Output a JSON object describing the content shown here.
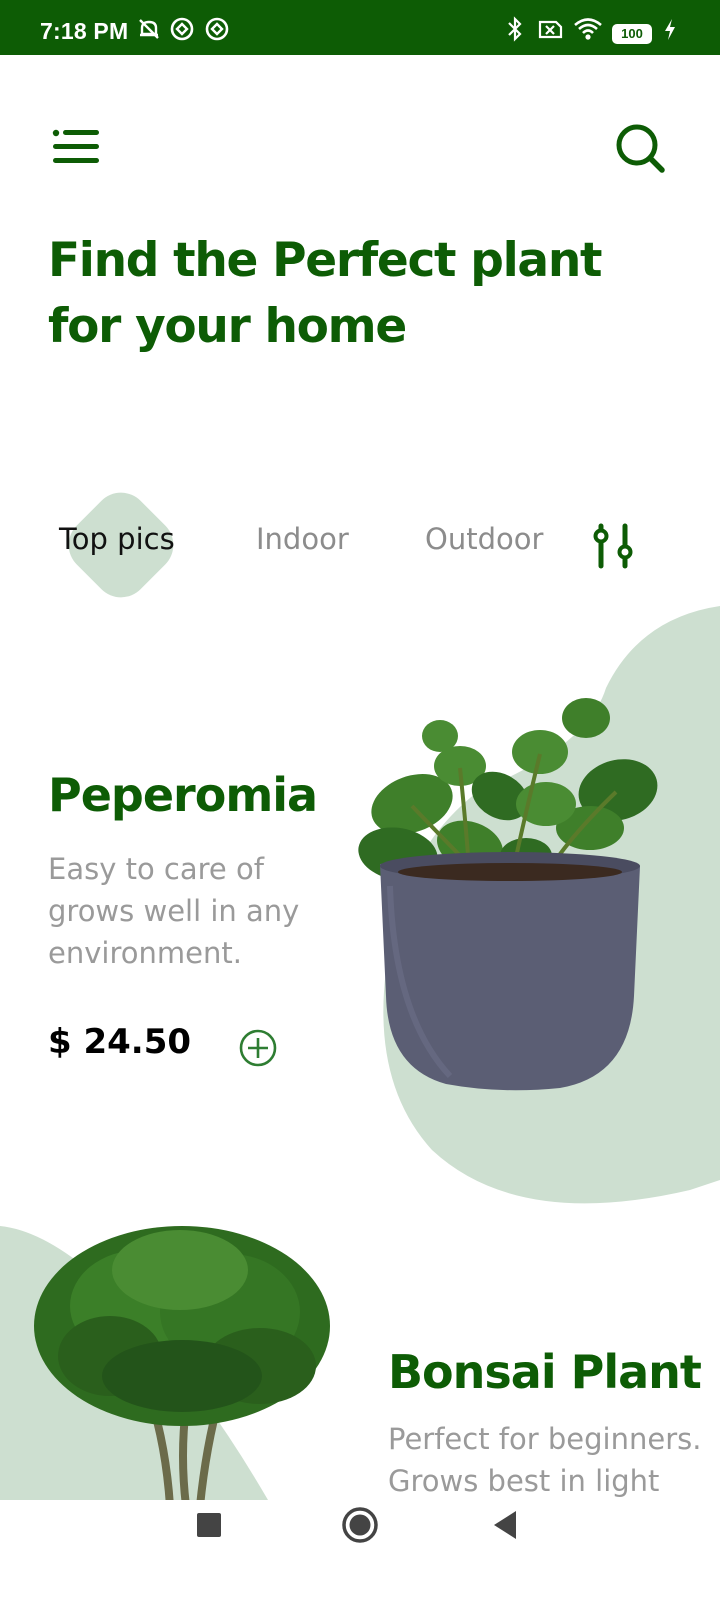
{
  "status_bar": {
    "time": "7:18 PM",
    "battery": "100",
    "icons": [
      "silent-icon",
      "sync-icon",
      "sync-icon",
      "bluetooth-icon",
      "sim-off-icon",
      "wifi-icon",
      "battery-icon",
      "charging-icon"
    ]
  },
  "header": {
    "menu_icon": "menu-icon",
    "search_icon": "search-icon",
    "title": "Find the Perfect plant for your home"
  },
  "tabs": [
    {
      "label": "Top pics",
      "active": true
    },
    {
      "label": "Indoor",
      "active": false
    },
    {
      "label": "Outdoor",
      "active": false
    }
  ],
  "filter_icon": "filter-sliders-icon",
  "plants": [
    {
      "name": "Peperomia",
      "description": "Easy to care of grows well in any environment.",
      "price": "$ 24.50",
      "add_icon": "add-circle-icon"
    },
    {
      "name": "Bonsai Plant",
      "description_lines": [
        "Perfect for beginners.",
        "Grows best in light"
      ]
    }
  ],
  "nav_bar": {
    "icons": [
      "recents-icon",
      "home-icon",
      "back-icon"
    ]
  },
  "colors": {
    "primary": "#0d5c05",
    "blob": "#cddfd0",
    "muted_text": "#9a9a9a"
  }
}
